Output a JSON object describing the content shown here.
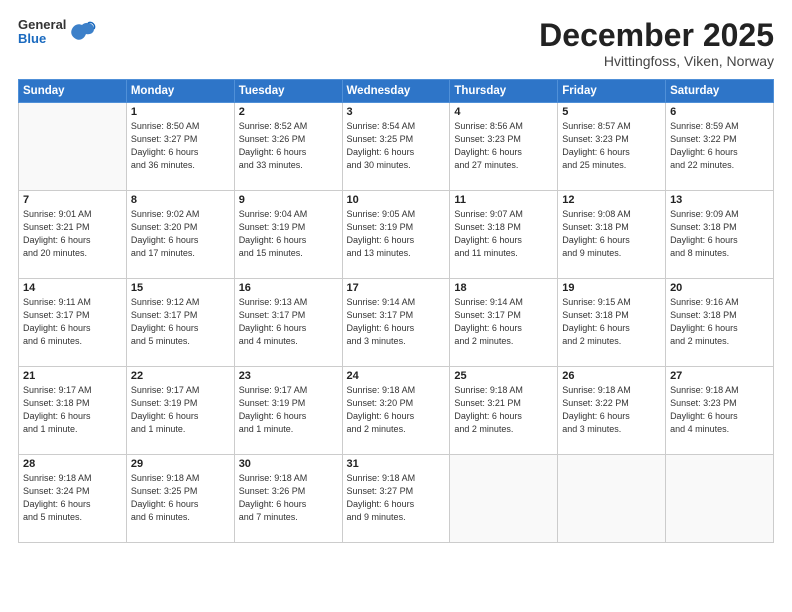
{
  "header": {
    "logo": {
      "general": "General",
      "blue": "Blue"
    },
    "title": "December 2025",
    "location": "Hvittingfoss, Viken, Norway"
  },
  "calendar": {
    "days_of_week": [
      "Sunday",
      "Monday",
      "Tuesday",
      "Wednesday",
      "Thursday",
      "Friday",
      "Saturday"
    ],
    "weeks": [
      [
        {
          "day": "",
          "info": ""
        },
        {
          "day": "1",
          "info": "Sunrise: 8:50 AM\nSunset: 3:27 PM\nDaylight: 6 hours\nand 36 minutes."
        },
        {
          "day": "2",
          "info": "Sunrise: 8:52 AM\nSunset: 3:26 PM\nDaylight: 6 hours\nand 33 minutes."
        },
        {
          "day": "3",
          "info": "Sunrise: 8:54 AM\nSunset: 3:25 PM\nDaylight: 6 hours\nand 30 minutes."
        },
        {
          "day": "4",
          "info": "Sunrise: 8:56 AM\nSunset: 3:23 PM\nDaylight: 6 hours\nand 27 minutes."
        },
        {
          "day": "5",
          "info": "Sunrise: 8:57 AM\nSunset: 3:23 PM\nDaylight: 6 hours\nand 25 minutes."
        },
        {
          "day": "6",
          "info": "Sunrise: 8:59 AM\nSunset: 3:22 PM\nDaylight: 6 hours\nand 22 minutes."
        }
      ],
      [
        {
          "day": "7",
          "info": "Sunrise: 9:01 AM\nSunset: 3:21 PM\nDaylight: 6 hours\nand 20 minutes."
        },
        {
          "day": "8",
          "info": "Sunrise: 9:02 AM\nSunset: 3:20 PM\nDaylight: 6 hours\nand 17 minutes."
        },
        {
          "day": "9",
          "info": "Sunrise: 9:04 AM\nSunset: 3:19 PM\nDaylight: 6 hours\nand 15 minutes."
        },
        {
          "day": "10",
          "info": "Sunrise: 9:05 AM\nSunset: 3:19 PM\nDaylight: 6 hours\nand 13 minutes."
        },
        {
          "day": "11",
          "info": "Sunrise: 9:07 AM\nSunset: 3:18 PM\nDaylight: 6 hours\nand 11 minutes."
        },
        {
          "day": "12",
          "info": "Sunrise: 9:08 AM\nSunset: 3:18 PM\nDaylight: 6 hours\nand 9 minutes."
        },
        {
          "day": "13",
          "info": "Sunrise: 9:09 AM\nSunset: 3:18 PM\nDaylight: 6 hours\nand 8 minutes."
        }
      ],
      [
        {
          "day": "14",
          "info": "Sunrise: 9:11 AM\nSunset: 3:17 PM\nDaylight: 6 hours\nand 6 minutes."
        },
        {
          "day": "15",
          "info": "Sunrise: 9:12 AM\nSunset: 3:17 PM\nDaylight: 6 hours\nand 5 minutes."
        },
        {
          "day": "16",
          "info": "Sunrise: 9:13 AM\nSunset: 3:17 PM\nDaylight: 6 hours\nand 4 minutes."
        },
        {
          "day": "17",
          "info": "Sunrise: 9:14 AM\nSunset: 3:17 PM\nDaylight: 6 hours\nand 3 minutes."
        },
        {
          "day": "18",
          "info": "Sunrise: 9:14 AM\nSunset: 3:17 PM\nDaylight: 6 hours\nand 2 minutes."
        },
        {
          "day": "19",
          "info": "Sunrise: 9:15 AM\nSunset: 3:18 PM\nDaylight: 6 hours\nand 2 minutes."
        },
        {
          "day": "20",
          "info": "Sunrise: 9:16 AM\nSunset: 3:18 PM\nDaylight: 6 hours\nand 2 minutes."
        }
      ],
      [
        {
          "day": "21",
          "info": "Sunrise: 9:17 AM\nSunset: 3:18 PM\nDaylight: 6 hours\nand 1 minute."
        },
        {
          "day": "22",
          "info": "Sunrise: 9:17 AM\nSunset: 3:19 PM\nDaylight: 6 hours\nand 1 minute."
        },
        {
          "day": "23",
          "info": "Sunrise: 9:17 AM\nSunset: 3:19 PM\nDaylight: 6 hours\nand 1 minute."
        },
        {
          "day": "24",
          "info": "Sunrise: 9:18 AM\nSunset: 3:20 PM\nDaylight: 6 hours\nand 2 minutes."
        },
        {
          "day": "25",
          "info": "Sunrise: 9:18 AM\nSunset: 3:21 PM\nDaylight: 6 hours\nand 2 minutes."
        },
        {
          "day": "26",
          "info": "Sunrise: 9:18 AM\nSunset: 3:22 PM\nDaylight: 6 hours\nand 3 minutes."
        },
        {
          "day": "27",
          "info": "Sunrise: 9:18 AM\nSunset: 3:23 PM\nDaylight: 6 hours\nand 4 minutes."
        }
      ],
      [
        {
          "day": "28",
          "info": "Sunrise: 9:18 AM\nSunset: 3:24 PM\nDaylight: 6 hours\nand 5 minutes."
        },
        {
          "day": "29",
          "info": "Sunrise: 9:18 AM\nSunset: 3:25 PM\nDaylight: 6 hours\nand 6 minutes."
        },
        {
          "day": "30",
          "info": "Sunrise: 9:18 AM\nSunset: 3:26 PM\nDaylight: 6 hours\nand 7 minutes."
        },
        {
          "day": "31",
          "info": "Sunrise: 9:18 AM\nSunset: 3:27 PM\nDaylight: 6 hours\nand 9 minutes."
        },
        {
          "day": "",
          "info": ""
        },
        {
          "day": "",
          "info": ""
        },
        {
          "day": "",
          "info": ""
        }
      ]
    ]
  }
}
